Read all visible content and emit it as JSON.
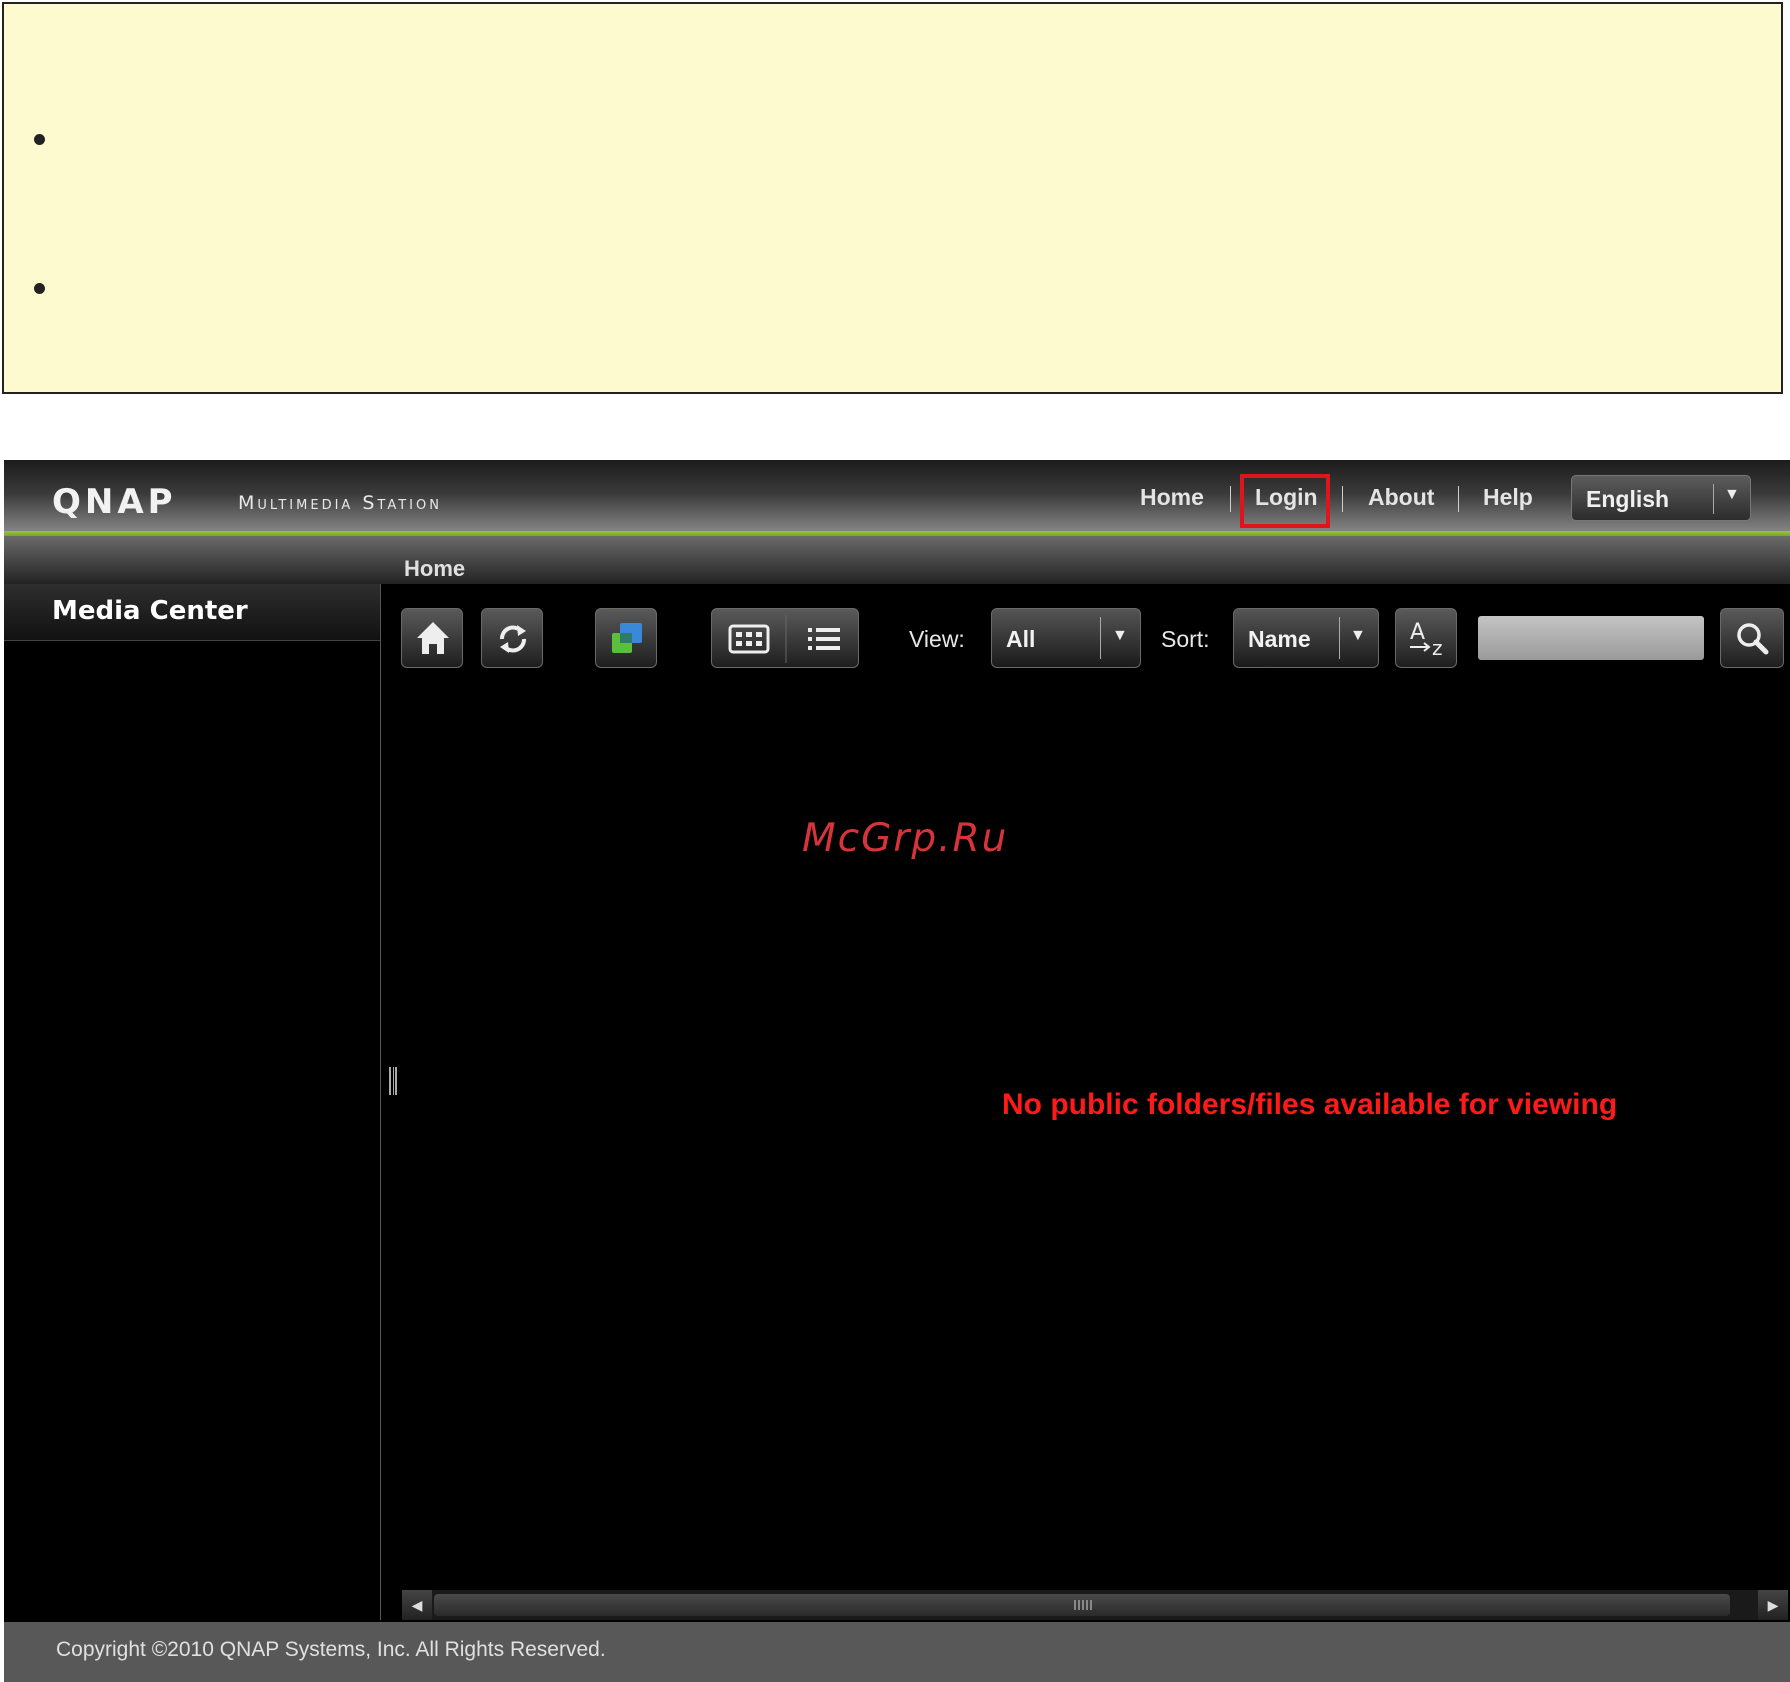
{
  "header": {
    "logo": "QNAP",
    "subtitle": "Multimedia Station",
    "nav": {
      "home": "Home",
      "login": "Login",
      "about": "About",
      "help": "Help"
    },
    "language": "English"
  },
  "breadcrumb": "Home",
  "sidebar": {
    "items": [
      {
        "label": "Media Center"
      }
    ]
  },
  "toolbar": {
    "view_label": "View:",
    "view_value": "All",
    "sort_label": "Sort:",
    "sort_value": "Name",
    "search_value": ""
  },
  "main": {
    "watermark": "McGrp.Ru",
    "empty_message": "No public folders/files available for viewing"
  },
  "footer": {
    "copyright": "Copyright ©2010 QNAP Systems, Inc. All Rights Reserved."
  },
  "colors": {
    "accent_green": "#8cbc30",
    "highlight_red": "#e0141b",
    "message_red": "#ff1a1a",
    "note_background": "#fefad0"
  },
  "icons": [
    "home-icon",
    "refresh-icon",
    "windows-icon",
    "grid-view-icon",
    "list-view-icon",
    "sort-az-icon",
    "search-icon",
    "chevron-down-icon"
  ]
}
